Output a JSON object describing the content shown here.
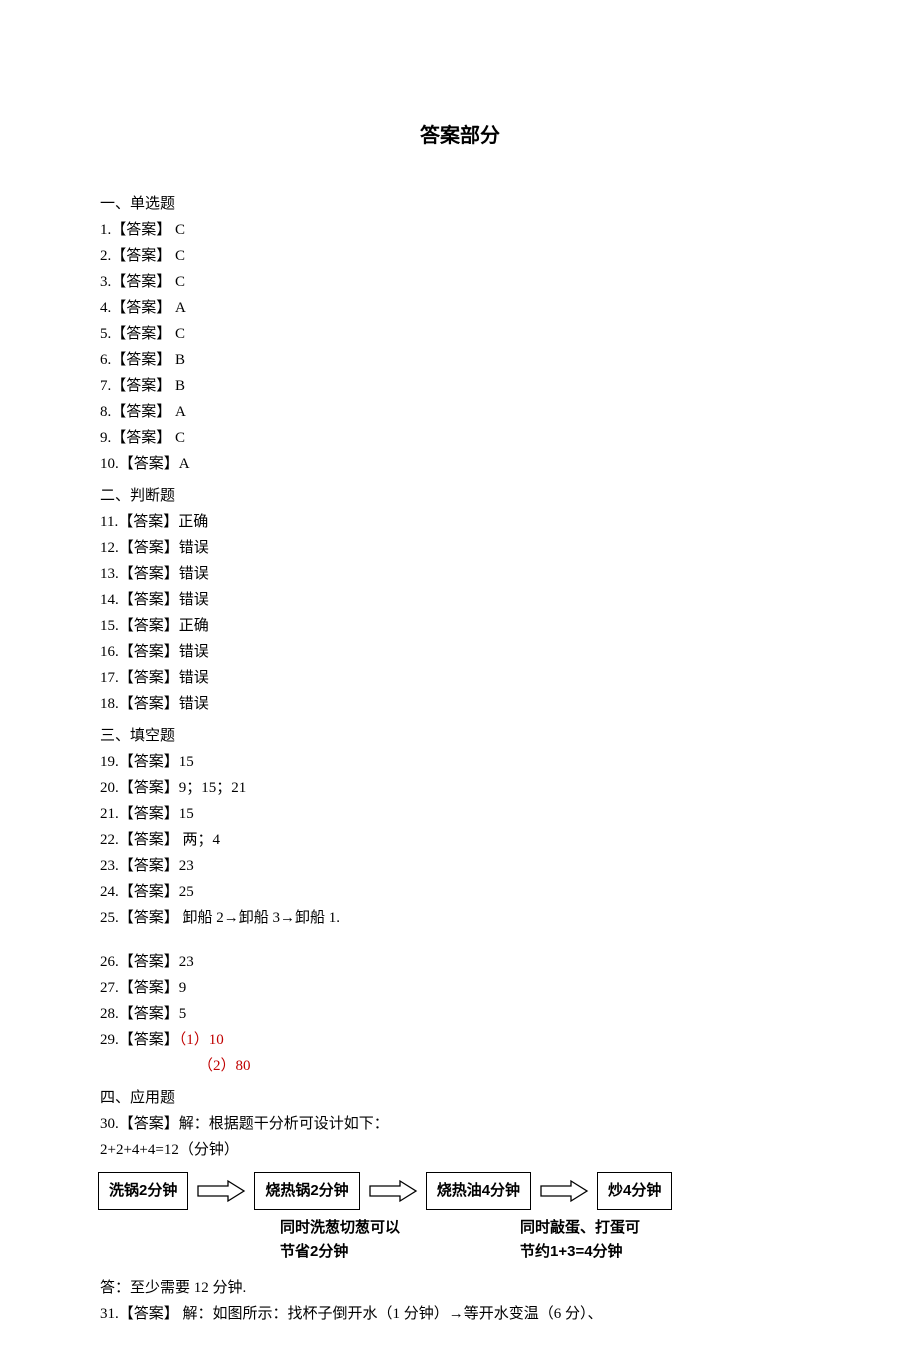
{
  "title": "答案部分",
  "section1": {
    "heading": "一、单选题"
  },
  "mcq": {
    "q1": {
      "num": "1.",
      "label": "【答案】",
      "ans": " C"
    },
    "q2": {
      "num": "2.",
      "label": "【答案】",
      "ans": " C"
    },
    "q3": {
      "num": "3.",
      "label": "【答案】",
      "ans": " C"
    },
    "q4": {
      "num": "4.",
      "label": "【答案】",
      "ans": " A"
    },
    "q5": {
      "num": "5.",
      "label": "【答案】",
      "ans": " C"
    },
    "q6": {
      "num": "6.",
      "label": "【答案】",
      "ans": " B"
    },
    "q7": {
      "num": "7.",
      "label": "【答案】",
      "ans": " B"
    },
    "q8": {
      "num": "8.",
      "label": "【答案】",
      "ans": " A"
    },
    "q9": {
      "num": "9.",
      "label": "【答案】",
      "ans": " C"
    },
    "q10": {
      "num": "10.",
      "label": "【答案】",
      "ans": "A"
    }
  },
  "section2": {
    "heading": "二、判断题"
  },
  "tf": {
    "q11": {
      "num": "11.",
      "label": "【答案】",
      "ans": "正确"
    },
    "q12": {
      "num": "12.",
      "label": "【答案】",
      "ans": "错误"
    },
    "q13": {
      "num": "13.",
      "label": "【答案】",
      "ans": "错误"
    },
    "q14": {
      "num": "14.",
      "label": "【答案】",
      "ans": "错误"
    },
    "q15": {
      "num": "15.",
      "label": "【答案】",
      "ans": "正确"
    },
    "q16": {
      "num": "16.",
      "label": "【答案】",
      "ans": "错误"
    },
    "q17": {
      "num": "17.",
      "label": "【答案】",
      "ans": "错误"
    },
    "q18": {
      "num": "18.",
      "label": "【答案】",
      "ans": "错误"
    }
  },
  "section3": {
    "heading": "三、填空题"
  },
  "fill": {
    "q19": {
      "num": "19.",
      "label": "【答案】",
      "ans": "15"
    },
    "q20": {
      "num": "20.",
      "label": "【答案】",
      "ans": "9；15；21"
    },
    "q21": {
      "num": "21.",
      "label": "【答案】",
      "ans": "15"
    },
    "q22": {
      "num": "22.",
      "label": "【答案】",
      "ans": " 两；4"
    },
    "q23": {
      "num": "23.",
      "label": "【答案】",
      "ans": "23"
    },
    "q24": {
      "num": "24.",
      "label": "【答案】",
      "ans": "25"
    },
    "q25": {
      "num": "25.",
      "label": "【答案】",
      "ans": " 卸船 2→卸船 3→卸船 1."
    },
    "q26": {
      "num": "26.",
      "label": "【答案】",
      "ans": "23"
    },
    "q27": {
      "num": "27.",
      "label": "【答案】",
      "ans": "9"
    },
    "q28": {
      "num": "28.",
      "label": "【答案】",
      "ans": "5"
    },
    "q29": {
      "num": "29.",
      "label": "【答案】",
      "ans1": "（1）10",
      "ans2": "（2）80"
    }
  },
  "section4": {
    "heading": "四、应用题"
  },
  "app": {
    "q30": {
      "num": "30.",
      "label": "【答案】",
      "solution_prefix": "解：根据题干分析可设计如下：",
      "calc": "2+2+4+4=12（分钟）",
      "step1": "洗锅2分钟",
      "step2": "烧热锅2分钟",
      "step3": "烧热油4分钟",
      "step4": "炒4分钟",
      "note1a": "同时洗葱切葱可以",
      "note1b": "节省2分钟",
      "note2a": "同时敲蛋、打蛋可",
      "note2b": "节约1+3=4分钟",
      "final": "答：至少需要 12 分钟."
    },
    "q31": {
      "num": "31.",
      "label": "【答案】",
      "text": " 解：如图所示：找杯子倒开水（1 分钟）→等开水变温（6 分）、"
    }
  }
}
